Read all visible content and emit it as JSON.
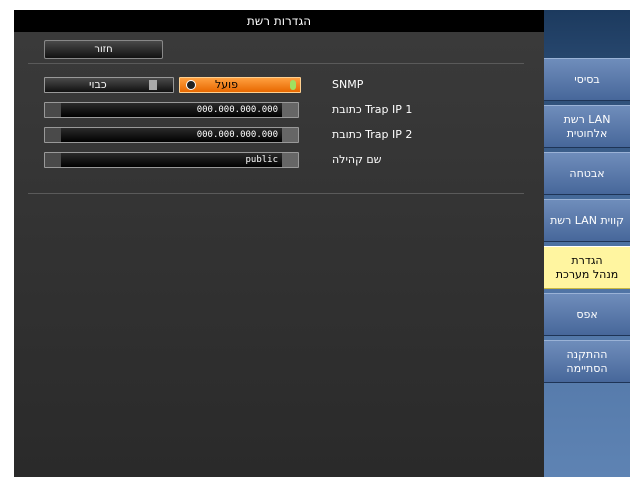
{
  "window": {
    "title": "הגדרות רשת"
  },
  "back_button": {
    "label": "חזור"
  },
  "rows": {
    "snmp": {
      "label": "SNMP",
      "on_label": "פועל",
      "off_label": "כבוי",
      "selected": "on"
    },
    "trap_ip_1": {
      "label": "כתובת Trap IP 1",
      "value": "000.000.000.000"
    },
    "trap_ip_2": {
      "label": "כתובת Trap IP 2",
      "value": "000.000.000.000"
    },
    "community_name": {
      "label": "שם קהילה",
      "value": "public"
    }
  },
  "sidebar": {
    "items": [
      {
        "label": "בסיסי"
      },
      {
        "label": "רשת LAN\nאלחוטית"
      },
      {
        "label": "אבטחה"
      },
      {
        "label": "רשת LAN קווית"
      },
      {
        "label": "הגדרת\nמנהל מערכת",
        "active": true
      },
      {
        "label": "אפס"
      },
      {
        "label": "ההתקנה\nהסתיימה"
      }
    ]
  },
  "colors": {
    "active_tab": "#fff5a0",
    "selected_option": "#ff8a20",
    "sidebar_blue": "#5a7aaa"
  }
}
